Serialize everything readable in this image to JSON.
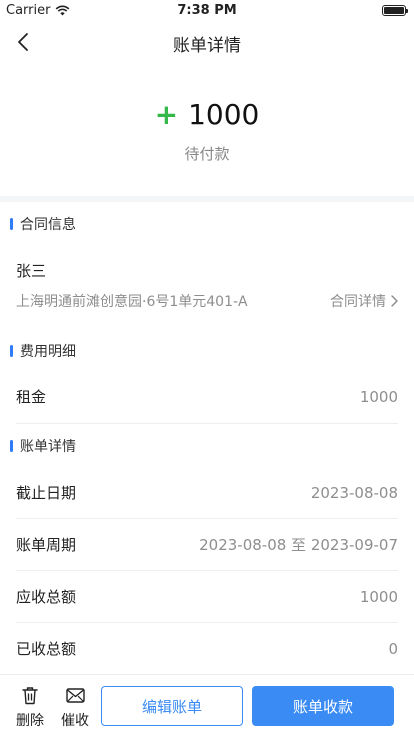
{
  "status_bar": {
    "carrier": "Carrier",
    "time": "7:38 PM"
  },
  "nav": {
    "title": "账单详情"
  },
  "summary": {
    "sign": "+",
    "amount": "1000",
    "status": "待付款"
  },
  "contract": {
    "section_title": "合同信息",
    "tenant": "张三",
    "address": "上海明通前滩创意园·6号1单元401-A",
    "detail_link": "合同详情"
  },
  "fees": {
    "section_title": "费用明细",
    "items": [
      {
        "label": "租金",
        "value": "1000"
      }
    ]
  },
  "bill": {
    "section_title": "账单详情",
    "rows": [
      {
        "label": "截止日期",
        "value": "2023-08-08"
      },
      {
        "label": "账单周期",
        "value": "2023-08-08 至 2023-09-07"
      },
      {
        "label": "应收总额",
        "value": "1000"
      },
      {
        "label": "已收总额",
        "value": "0"
      }
    ]
  },
  "bottom": {
    "delete_label": "删除",
    "remind_label": "催收",
    "edit_label": "编辑账单",
    "collect_label": "账单收款"
  },
  "colors": {
    "accent": "#3a8bf3",
    "positive": "#35b84a",
    "section_bar": "#2f7cf6"
  },
  "icons": [
    "wifi-icon",
    "battery-icon",
    "back-icon",
    "chevron-right-icon",
    "trash-icon",
    "envelope-icon"
  ]
}
